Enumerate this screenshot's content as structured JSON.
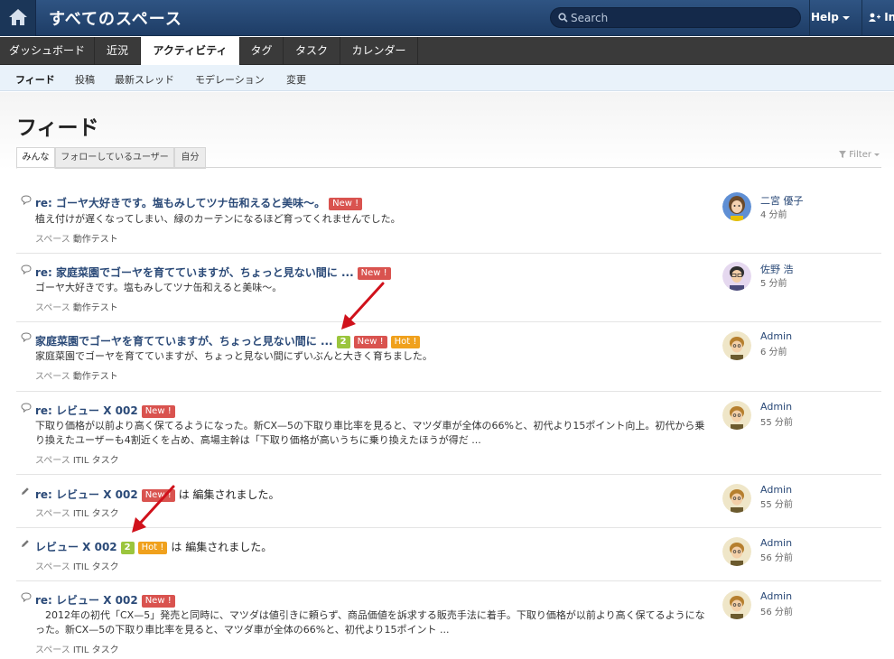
{
  "topbar": {
    "space_title": "すべてのスペース",
    "search_placeholder": "Search",
    "help_label": "Help",
    "invite_label": "In"
  },
  "nav": {
    "items": [
      "ダッシュボード",
      "近況",
      "アクティビティ",
      "タグ",
      "タスク",
      "カレンダー"
    ],
    "active": "アクティビティ"
  },
  "subnav": {
    "items": [
      "フィード",
      "投稿",
      "最新スレッド",
      "モデレーション",
      "変更"
    ],
    "active": "フィード"
  },
  "page": {
    "title": "フィード",
    "tabs": [
      "みんな",
      "フォローしているユーザー",
      "自分"
    ],
    "active_tab": "みんな",
    "filter_label": "Filter"
  },
  "feed": [
    {
      "icon": "comment-icon",
      "title": "re: ゴーヤ大好きです。塩もみしてツナ缶和えると美味〜。",
      "badges": [
        "New !"
      ],
      "body": "植え付けが遅くなってしまい、緑のカーテンになるほど育ってくれませんでした。",
      "meta_label": "スペース",
      "space": "動作テスト",
      "user": "二宮 優子",
      "time": "4 分前"
    },
    {
      "icon": "comment-icon",
      "title": "re: 家庭菜園でゴーヤを育てていますが、ちょっと見ない間に ...",
      "badges": [
        "New !"
      ],
      "body": "ゴーヤ大好きです。塩もみしてツナ缶和えると美味〜。",
      "meta_label": "スペース",
      "space": "動作テスト",
      "user": "佐野 浩",
      "time": "5 分前"
    },
    {
      "icon": "comment-icon",
      "title": "家庭菜園でゴーヤを育てていますが、ちょっと見ない間に ...",
      "count": "2",
      "badges": [
        "New !",
        "Hot !"
      ],
      "body": "家庭菜園でゴーヤを育てていますが、ちょっと見ない間にずいぶんと大きく育ちました。",
      "meta_label": "スペース",
      "space": "動作テスト",
      "user": "Admin",
      "time": "6 分前"
    },
    {
      "icon": "comment-icon",
      "title": "re: レビュー X 002",
      "badges": [
        "New !"
      ],
      "body": "下取り価格が以前より高く保てるようになった。新CX—5の下取り車比率を見ると、マツダ車が全体の66%と、初代より15ポイント向上。初代から乗り換えたユーザーも4割近くを占め、高場主幹は「下取り価格が高いうちに乗り換えたほうが得だ ...",
      "meta_label": "スペース",
      "space": "ITIL タスク",
      "user": "Admin",
      "time": "55 分前"
    },
    {
      "icon": "pencil-icon",
      "title": "re: レビュー X 002",
      "badges": [
        "New !"
      ],
      "suffix": "は 編集されました。",
      "body": "",
      "meta_label": "スペース",
      "space": "ITIL タスク",
      "user": "Admin",
      "time": "55 分前"
    },
    {
      "icon": "pencil-icon",
      "title": "レビュー X 002",
      "count": "2",
      "badges": [
        "Hot !"
      ],
      "suffix": "は 編集されました。",
      "body": "",
      "meta_label": "スペース",
      "space": "ITIL タスク",
      "user": "Admin",
      "time": "56 分前"
    },
    {
      "icon": "comment-icon",
      "title": "re: レビュー X 002",
      "badges": [
        "New !"
      ],
      "body": "　2012年の初代「CX—5」発売と同時に、マツダは値引きに頼らず、商品価値を訴求する販売手法に着手。下取り価格が以前より高く保てるようになった。新CX—5の下取り車比率を見ると、マツダ車が全体の66%と、初代より15ポイント ...",
      "meta_label": "スペース",
      "space": "ITIL タスク",
      "user": "Admin",
      "time": "56 分前"
    }
  ],
  "colors": {
    "topbar": "#2a4b78",
    "nav": "#3a3a3a",
    "subnav": "#e9f2fa",
    "link": "#2b4a78",
    "badge_new": "#d9534f",
    "badge_hot": "#f0a11d",
    "badge_count": "#9bc53d",
    "annotation_arrow": "#d0111b"
  }
}
